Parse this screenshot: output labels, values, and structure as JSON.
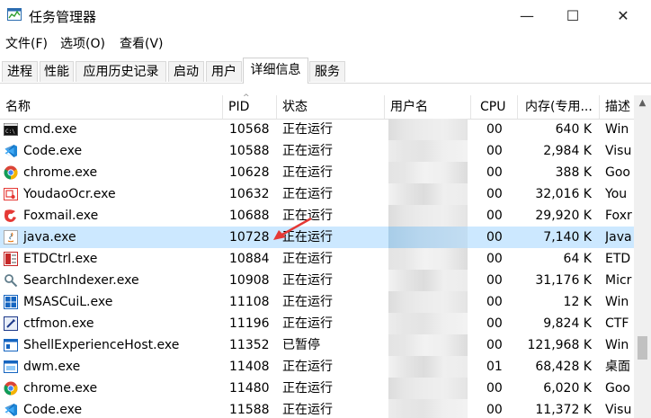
{
  "window": {
    "title": "任务管理器",
    "minimize": "—",
    "maximize": "☐",
    "close": "✕"
  },
  "menu": [
    "文件(F)",
    "选项(O)",
    "查看(V)"
  ],
  "tabs": [
    "进程",
    "性能",
    "应用历史记录",
    "启动",
    "用户",
    "详细信息",
    "服务"
  ],
  "active_tab": "详细信息",
  "columns": [
    "名称",
    "PID",
    "状态",
    "用户名",
    "CPU",
    "内存(专用...",
    "描述"
  ],
  "rows": [
    {
      "name": "cmd.exe",
      "pid": "10568",
      "status": "正在运行",
      "cpu": "00",
      "mem": "640 K",
      "desc": "Win",
      "icon": "cmd-icon"
    },
    {
      "name": "Code.exe",
      "pid": "10588",
      "status": "正在运行",
      "cpu": "00",
      "mem": "2,984 K",
      "desc": "Visu",
      "icon": "vscode-icon"
    },
    {
      "name": "chrome.exe",
      "pid": "10628",
      "status": "正在运行",
      "cpu": "00",
      "mem": "388 K",
      "desc": "Goo",
      "icon": "chrome-icon"
    },
    {
      "name": "YoudaoOcr.exe",
      "pid": "10632",
      "status": "正在运行",
      "cpu": "00",
      "mem": "32,016 K",
      "desc": "You",
      "icon": "youdao-icon"
    },
    {
      "name": "Foxmail.exe",
      "pid": "10688",
      "status": "正在运行",
      "cpu": "00",
      "mem": "29,920 K",
      "desc": "Foxr",
      "icon": "foxmail-icon"
    },
    {
      "name": "java.exe",
      "pid": "10728",
      "status": "正在运行",
      "cpu": "00",
      "mem": "7,140 K",
      "desc": "Java",
      "icon": "java-icon",
      "selected": true
    },
    {
      "name": "ETDCtrl.exe",
      "pid": "10884",
      "status": "正在运行",
      "cpu": "00",
      "mem": "64 K",
      "desc": "ETD",
      "icon": "etd-icon"
    },
    {
      "name": "SearchIndexer.exe",
      "pid": "10908",
      "status": "正在运行",
      "cpu": "00",
      "mem": "31,176 K",
      "desc": "Micr",
      "icon": "search-indexer-icon"
    },
    {
      "name": "MSASCuiL.exe",
      "pid": "11108",
      "status": "正在运行",
      "cpu": "00",
      "mem": "12 K",
      "desc": "Win",
      "icon": "defender-icon"
    },
    {
      "name": "ctfmon.exe",
      "pid": "11196",
      "status": "正在运行",
      "cpu": "00",
      "mem": "9,824 K",
      "desc": "CTF",
      "icon": "ctfmon-icon"
    },
    {
      "name": "ShellExperienceHost.exe",
      "pid": "11352",
      "status": "已暂停",
      "cpu": "00",
      "mem": "121,968 K",
      "desc": "Win",
      "icon": "window-icon"
    },
    {
      "name": "dwm.exe",
      "pid": "11408",
      "status": "正在运行",
      "cpu": "01",
      "mem": "68,428 K",
      "desc": "桌面",
      "icon": "dwm-icon"
    },
    {
      "name": "chrome.exe",
      "pid": "11480",
      "status": "正在运行",
      "cpu": "00",
      "mem": "6,020 K",
      "desc": "Goo",
      "icon": "chrome-icon"
    },
    {
      "name": "Code.exe",
      "pid": "11588",
      "status": "正在运行",
      "cpu": "00",
      "mem": "11,372 K",
      "desc": "Visu",
      "icon": "vscode-icon"
    }
  ]
}
